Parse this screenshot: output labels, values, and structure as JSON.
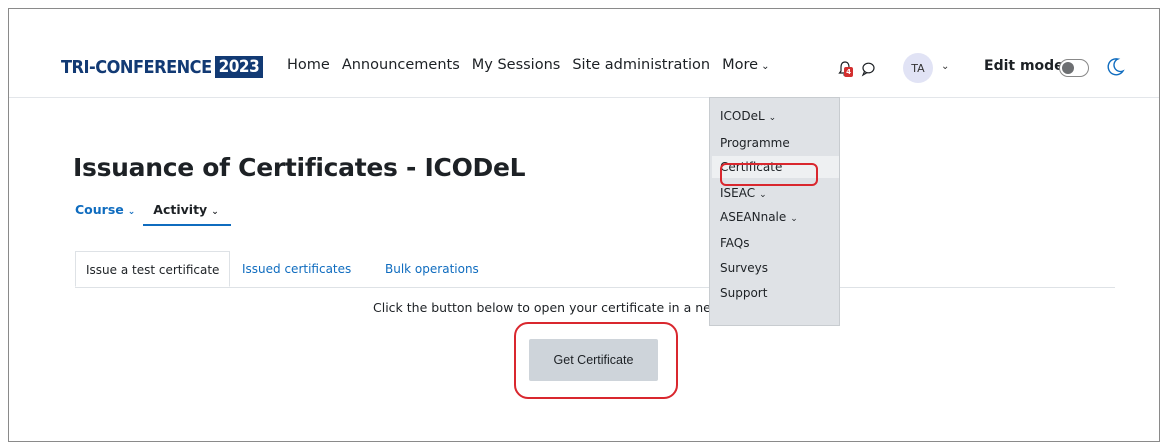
{
  "logo": {
    "text": "TRI-CONFERENCE",
    "year": "2023"
  },
  "nav": {
    "links": [
      "Home",
      "Announcements",
      "My Sessions",
      "Site administration"
    ],
    "more": "More",
    "notifications_count": "4",
    "avatar": "TA",
    "edit_mode": "Edit mode",
    "edit_mode_on": false
  },
  "page": {
    "title": "Issuance of Certificates - ICODeL",
    "secondary_nav": {
      "course": "Course",
      "activity": "Activity"
    },
    "tabs": [
      "Issue a test certificate",
      "Issued certificates",
      "Bulk operations"
    ],
    "intro": "Click the button below to open your certificate in a new",
    "button": "Get Certificate"
  },
  "dropdown": {
    "items": [
      {
        "label": "ICODeL",
        "submenu": true
      },
      {
        "label": "Programme",
        "submenu": false
      },
      {
        "label": "Certificate",
        "submenu": false,
        "highlighted": true
      },
      {
        "label": "ISEAC",
        "submenu": true
      },
      {
        "label": "ASEANnale",
        "submenu": true
      },
      {
        "label": "FAQs",
        "submenu": false
      },
      {
        "label": "Surveys",
        "submenu": false
      },
      {
        "label": "Support",
        "submenu": false
      }
    ]
  },
  "colors": {
    "brand": "#123a74",
    "link": "#0f6cbf",
    "annotation": "#d9272e",
    "badge": "#d32f2f"
  },
  "icons": [
    "bell-icon",
    "chat-icon",
    "chevron-down-icon",
    "moon-icon"
  ]
}
